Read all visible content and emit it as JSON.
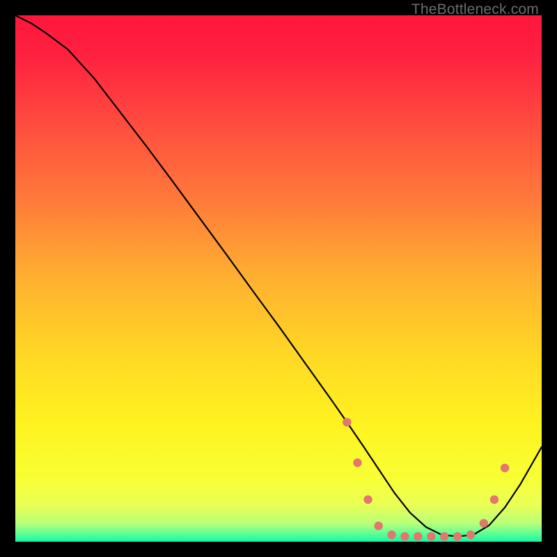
{
  "watermark": "TheBottleneck.com",
  "chart_data": {
    "type": "line",
    "title": "",
    "xlabel": "",
    "ylabel": "",
    "xlim": [
      0,
      100
    ],
    "ylim": [
      0,
      100
    ],
    "background_gradient": {
      "stops": [
        {
          "offset": 0.0,
          "color": "#ff163b"
        },
        {
          "offset": 0.08,
          "color": "#ff2240"
        },
        {
          "offset": 0.2,
          "color": "#ff4a3f"
        },
        {
          "offset": 0.35,
          "color": "#ff7a3a"
        },
        {
          "offset": 0.5,
          "color": "#ffb030"
        },
        {
          "offset": 0.65,
          "color": "#ffd924"
        },
        {
          "offset": 0.78,
          "color": "#fff321"
        },
        {
          "offset": 0.88,
          "color": "#f8ff35"
        },
        {
          "offset": 0.93,
          "color": "#eaff55"
        },
        {
          "offset": 0.965,
          "color": "#b9ff7a"
        },
        {
          "offset": 0.985,
          "color": "#5dff95"
        },
        {
          "offset": 1.0,
          "color": "#14f7a4"
        }
      ]
    },
    "series": [
      {
        "name": "bottleneck-curve",
        "color": "#000000",
        "x": [
          0,
          3,
          6,
          10,
          15,
          20,
          25,
          30,
          35,
          40,
          45,
          50,
          55,
          60,
          63,
          66,
          69,
          72,
          75,
          78,
          81,
          84,
          87,
          90,
          93,
          96,
          100
        ],
        "y": [
          100,
          98.5,
          96.5,
          93.5,
          88,
          81.5,
          75,
          68.3,
          61.5,
          54.7,
          47.8,
          41,
          34,
          27,
          22.7,
          18.3,
          13.8,
          9.3,
          5.5,
          2.8,
          1.3,
          1.0,
          1.3,
          3.1,
          6.5,
          11.0,
          18.0
        ]
      }
    ],
    "markers": {
      "name": "highlight-dots",
      "color": "#e2776e",
      "radius": 6.2,
      "points": [
        {
          "x": 63.0,
          "y": 22.7
        },
        {
          "x": 65.0,
          "y": 15.0
        },
        {
          "x": 67.0,
          "y": 8.0
        },
        {
          "x": 69.0,
          "y": 3.0
        },
        {
          "x": 71.5,
          "y": 1.3
        },
        {
          "x": 74.0,
          "y": 1.0
        },
        {
          "x": 76.5,
          "y": 1.0
        },
        {
          "x": 79.0,
          "y": 1.0
        },
        {
          "x": 81.5,
          "y": 1.0
        },
        {
          "x": 84.0,
          "y": 1.0
        },
        {
          "x": 86.5,
          "y": 1.3
        },
        {
          "x": 89.0,
          "y": 3.5
        },
        {
          "x": 91.0,
          "y": 8.0
        },
        {
          "x": 93.0,
          "y": 14.0
        }
      ]
    }
  }
}
